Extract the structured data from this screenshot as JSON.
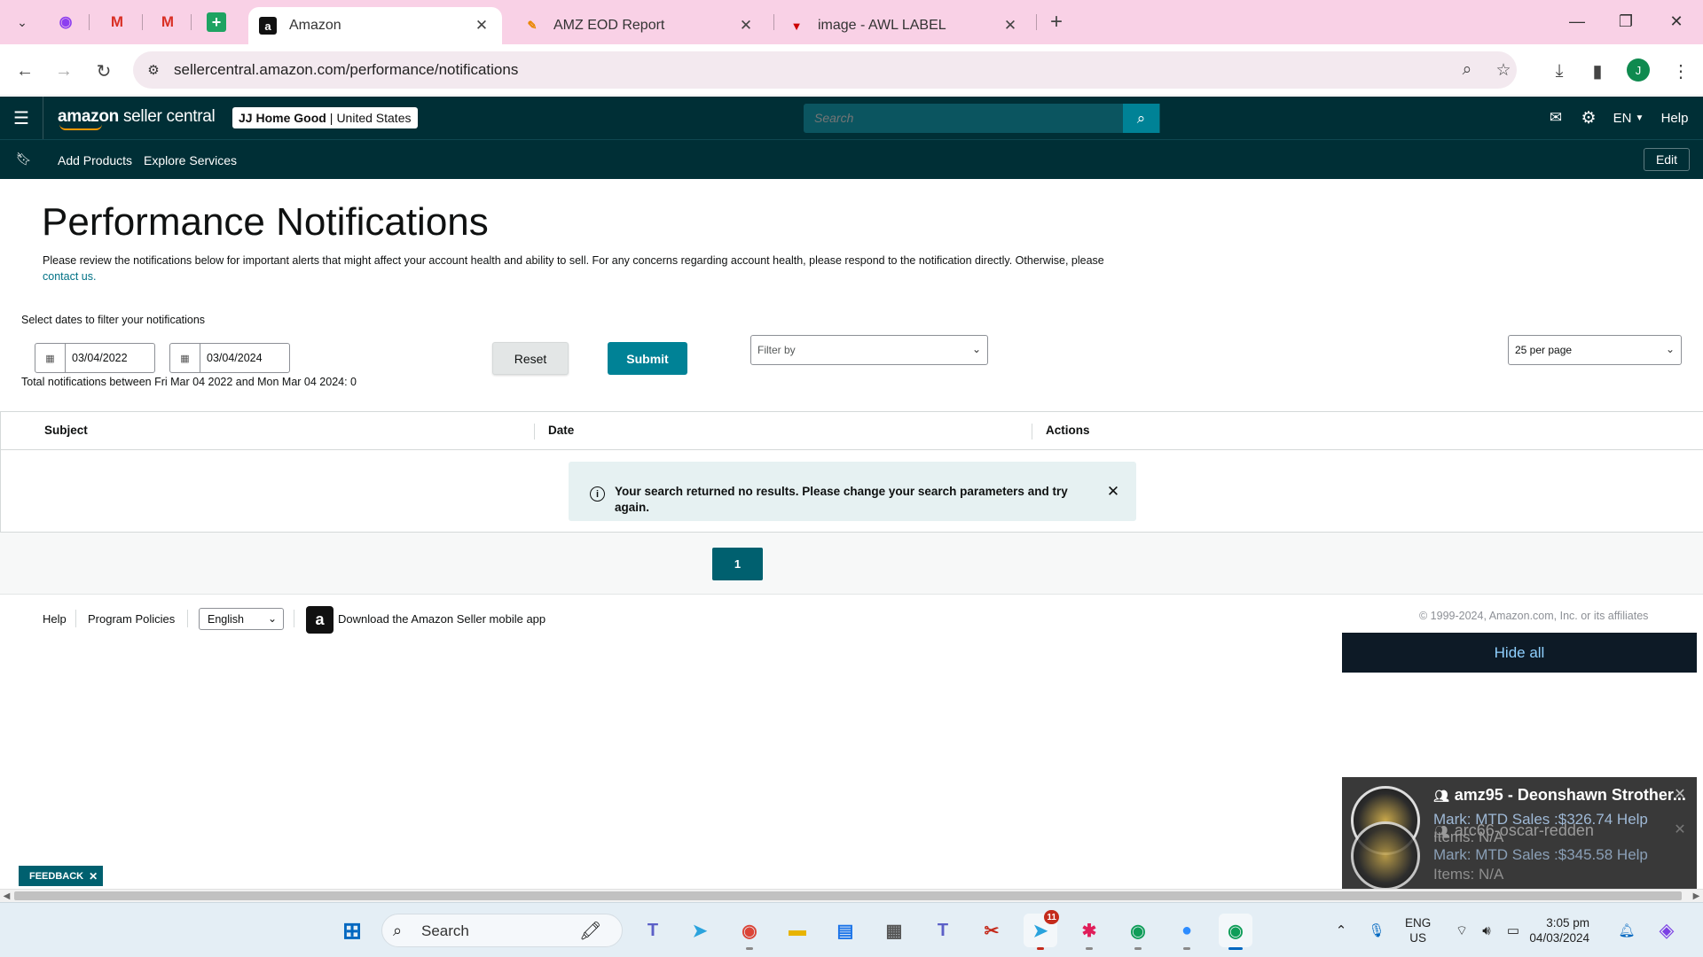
{
  "browser": {
    "tabs": [
      {
        "title": "Amazon",
        "active": true
      },
      {
        "title": "AMZ EOD Report",
        "active": false
      },
      {
        "title": "image - AWL LABEL",
        "active": false
      }
    ],
    "url": "sellercentral.amazon.com/performance/notifications",
    "profile_initial": "J"
  },
  "header": {
    "logo_brand": "amazon",
    "logo_product": "seller central",
    "account_name": "JJ Home Good",
    "account_sep": "|",
    "account_region": "United States",
    "search_placeholder": "Search",
    "lang": "EN",
    "help": "Help"
  },
  "subnav": {
    "links": [
      "Add Products",
      "Explore Services"
    ],
    "edit": "Edit"
  },
  "page": {
    "title": "Performance Notifications",
    "description": "Please review the notifications below for important alerts that might affect your account health and ability to sell. For any concerns regarding account health, please respond to the notification directly. Otherwise, please",
    "contact_link": "contact us.",
    "filter_label": "Select dates to filter your notifications",
    "date_from": "03/04/2022",
    "date_to": "03/04/2024",
    "total_text": "Total notifications between Fri Mar 04 2022 and Mon Mar 04 2024: 0",
    "reset": "Reset",
    "submit": "Submit",
    "filter_by": "Filter by",
    "per_page": "25 per page"
  },
  "table": {
    "columns": [
      "Subject",
      "Date",
      "Actions"
    ],
    "alert": "Your search returned no results. Please change your search parameters and try again.",
    "page": "1"
  },
  "footer": {
    "help": "Help",
    "policies": "Program Policies",
    "language": "English",
    "app_text": "Download the Amazon Seller mobile app",
    "copyright": "© 1999-2024, Amazon.com, Inc. or its affiliates"
  },
  "overlay": {
    "hide_all": "Hide all",
    "toasts": [
      {
        "title": "amz95 - Deonshawn Strother...",
        "line1": "Mark: MTD Sales :$326.74 Help",
        "line2": "Items: N/A"
      },
      {
        "title": "arc66-oscar-redden",
        "line1": "Mark: MTD Sales :$345.58 Help",
        "line2": "Items: N/A"
      }
    ],
    "feedback": "FEEDBACK"
  },
  "taskbar": {
    "search": "Search",
    "telegram_badge": "11",
    "lang_line1": "ENG",
    "lang_line2": "US",
    "time": "3:05 pm",
    "date": "04/03/2024"
  },
  "colors": {
    "tabstrip": "#f9d1e6",
    "seller_header": "#002f36",
    "accent_teal": "#008296",
    "link": "#007185"
  }
}
